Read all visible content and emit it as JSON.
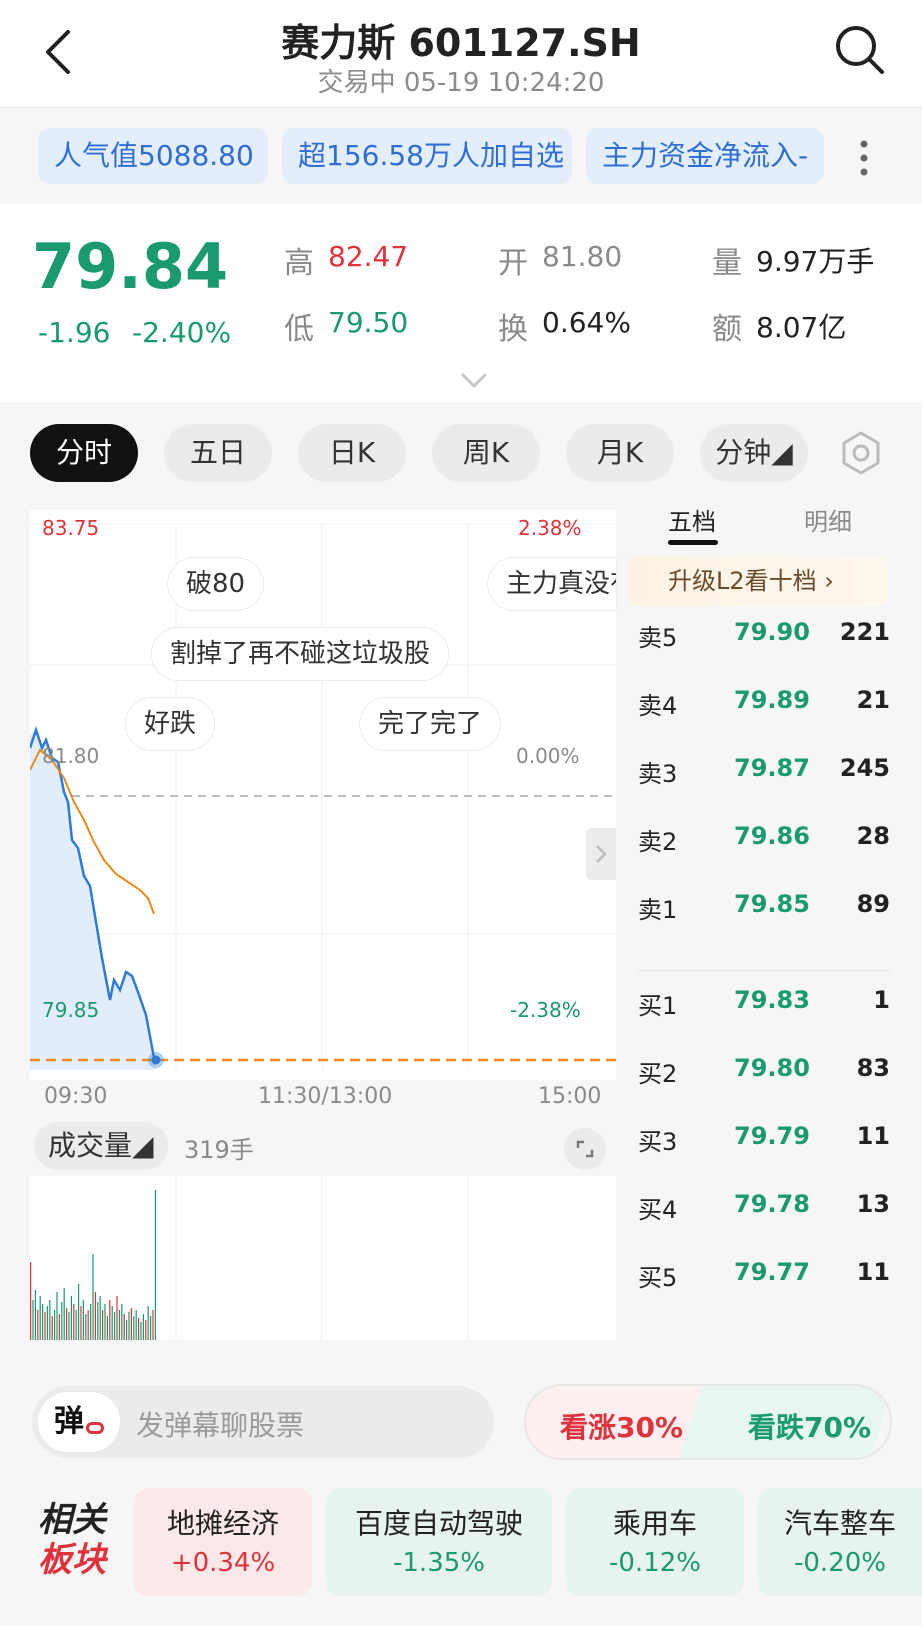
{
  "header": {
    "title": "赛力斯 601127.SH",
    "subtitle": "交易中 05-19 10:24:20"
  },
  "tags": [
    {
      "label": "人气值5088.80"
    },
    {
      "label": "超156.58万人加自选"
    },
    {
      "label": "主力资金净流入-"
    }
  ],
  "quote": {
    "price": "79.84",
    "change": "-1.96",
    "change_pct": "-2.40%",
    "high_label": "高",
    "high": "82.47",
    "low_label": "低",
    "low": "79.50",
    "open_label": "开",
    "open": "81.80",
    "turnover_label": "换",
    "turnover": "0.64%",
    "volume_label": "量",
    "volume": "9.97万手",
    "amount_label": "额",
    "amount": "8.07亿"
  },
  "period_tabs": [
    {
      "label": "分时",
      "active": true
    },
    {
      "label": "五日"
    },
    {
      "label": "日K"
    },
    {
      "label": "周K"
    },
    {
      "label": "月K"
    },
    {
      "label": "分钟◢"
    }
  ],
  "chart": {
    "top_price": "83.75",
    "top_pct": "2.38%",
    "mid_price": "81.80",
    "mid_pct": "0.00%",
    "bottom_price": "79.85",
    "bottom_pct": "-2.38%",
    "time_start": "09:30",
    "time_mid": "11:30/13:00",
    "time_end": "15:00"
  },
  "danmaku": [
    {
      "text": "破80"
    },
    {
      "text": "主力真没有"
    },
    {
      "text": "割掉了再不碰这垃圾股"
    },
    {
      "text": "好跌"
    },
    {
      "text": "完了完了"
    }
  ],
  "volume": {
    "dropdown_label": "成交量◢",
    "value": "319手"
  },
  "order_book": {
    "tab_active": "五档",
    "tab_other": "明细",
    "upgrade_label": "升级L2看十档 ›",
    "asks": [
      {
        "label": "卖5",
        "price": "79.90",
        "volume": "221"
      },
      {
        "label": "卖4",
        "price": "79.89",
        "volume": "21"
      },
      {
        "label": "卖3",
        "price": "79.87",
        "volume": "245"
      },
      {
        "label": "卖2",
        "price": "79.86",
        "volume": "28"
      },
      {
        "label": "卖1",
        "price": "79.85",
        "volume": "89"
      }
    ],
    "bids": [
      {
        "label": "买1",
        "price": "79.83",
        "volume": "1"
      },
      {
        "label": "买2",
        "price": "79.80",
        "volume": "83"
      },
      {
        "label": "买3",
        "price": "79.79",
        "volume": "11"
      },
      {
        "label": "买4",
        "price": "79.78",
        "volume": "13"
      },
      {
        "label": "买5",
        "price": "79.77",
        "volume": "11"
      }
    ]
  },
  "danmu_input": {
    "icon_label": "弹",
    "placeholder": "发弹幕聊股票"
  },
  "sentiment": {
    "bull": "看涨30%",
    "bear": "看跌70%"
  },
  "related": {
    "title_line1": "相关",
    "title_line2": "板块",
    "sectors": [
      {
        "name": "地摊经济",
        "change": "+0.34%"
      },
      {
        "name": "百度自动驾驶",
        "change": "-1.35%"
      },
      {
        "name": "乘用车",
        "change": "-0.12%"
      },
      {
        "name": "汽车整车",
        "change": "-0.20%"
      }
    ]
  },
  "colors": {
    "up": "#e0323c",
    "down": "#1a9a6e",
    "price_line": "#2f7bd6",
    "avg_line": "#e88a1a",
    "tag_text": "#2f6ed6"
  },
  "icons": {
    "back": "back-icon",
    "search": "search-icon",
    "more": "more-icon",
    "settings": "gear-icon",
    "expand": "expand-icon"
  }
}
